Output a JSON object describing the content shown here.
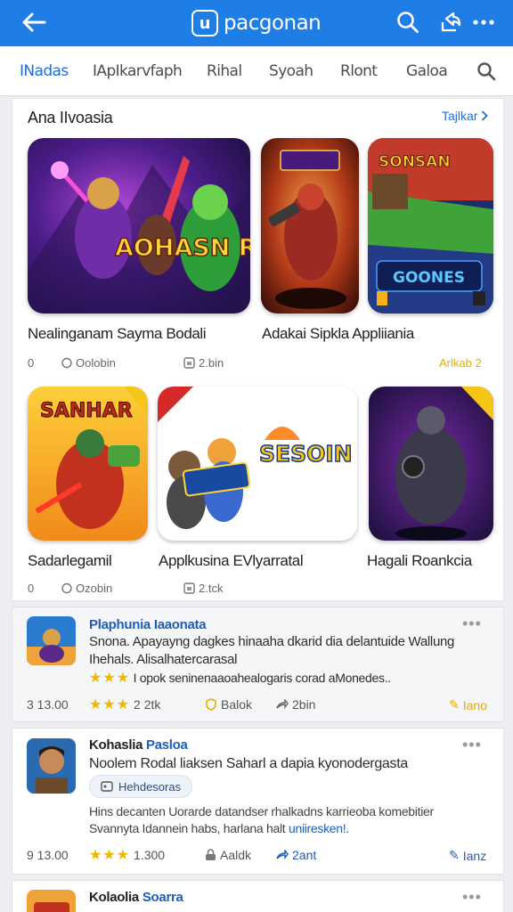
{
  "topbar": {
    "brand_logo": "u",
    "brand_name": "pacgonan"
  },
  "tabs": [
    {
      "label": "INadas"
    },
    {
      "label": "IApIkarvfaph"
    },
    {
      "label": "Rihal"
    },
    {
      "label": "Syoah"
    },
    {
      "label": "Rlont"
    },
    {
      "label": "Galoa"
    }
  ],
  "featured": {
    "title": "Ana IIvoasia",
    "see_all": "Tajlkar",
    "tiles": [
      {
        "art": "AOHASN RESONAICE"
      },
      {
        "art": "SONSAN"
      },
      {
        "art": "GOONES"
      },
      {
        "art": "SANHAR"
      },
      {
        "art": "SESOIN HIAGASES"
      }
    ],
    "row1": {
      "name_a": "Nealinganam Sayma Bodali",
      "name_b": "Adakai Sipkla Appliiania",
      "meta_a": "0",
      "meta_b": "Oolobin",
      "meta_c": "2.bin",
      "meta_d": "Arlkab 2"
    },
    "row2": {
      "name_a": "Sadarlegamil",
      "name_b": "Applkusina EVlyarratal",
      "name_c": "Hagali Roankcia",
      "meta_a": "0",
      "meta_b": "Ozobin",
      "meta_c": "2.tck"
    }
  },
  "list": [
    {
      "title": "Plaphunia Iaaonata",
      "line1": "Snona. Apayayng dagkes hinaaha dkarid dia delantuide Wallung",
      "line2": "Ihehals. Alisalhatercarasal",
      "line3": "I opok seninenaaoahealogaris corad aMonedes..",
      "size": "3 13.00",
      "rating": "2 2tk",
      "f2": "Balok",
      "f3": "2bin",
      "f4": "Iano"
    },
    {
      "title": "Kohaslia",
      "title_accent": "Pasloa",
      "line1": "Noolem Rodal liaksen Saharl a dapia kyonodergasta",
      "chip": "Hehdesoras",
      "line2": "Hins decanten Uorarde datandser rhalkadns karrieoba komebitier",
      "line3a": "Svannyta Idannein habs, harlana halt",
      "line3b": "uniiresken!.",
      "size": "9 13.00",
      "rating": "1.300",
      "f2": "Aaldk",
      "f3": "2ant",
      "f4": "Ianz"
    },
    {
      "title": "Kolaolia",
      "title_accent": "Soarra"
    }
  ]
}
